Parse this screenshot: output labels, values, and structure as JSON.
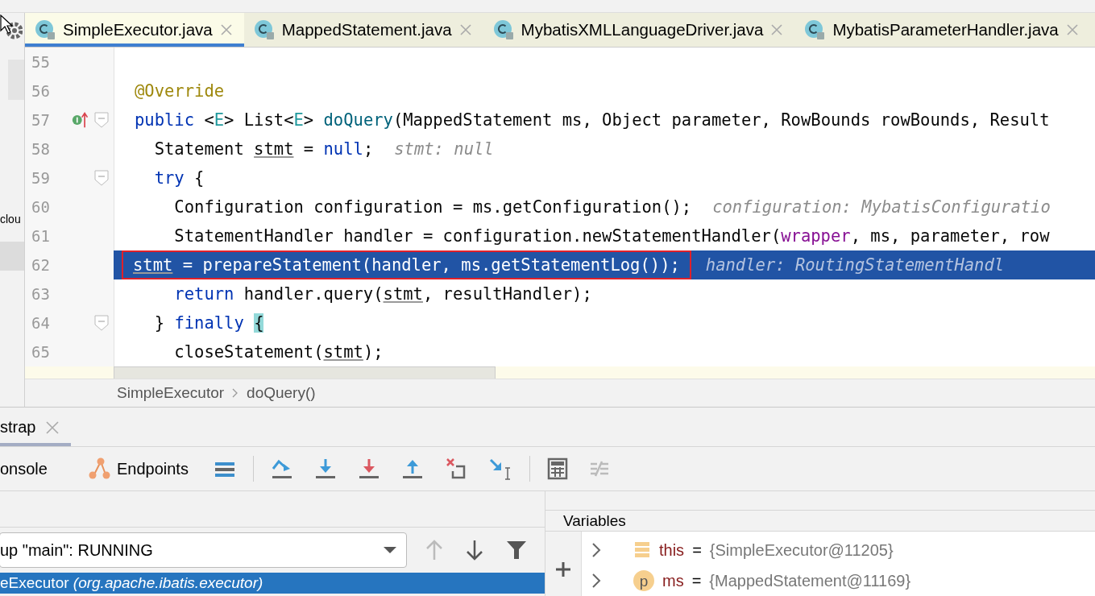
{
  "left_strip": {
    "text": "clou"
  },
  "editor_tabs": [
    {
      "label": "SimpleExecutor.java",
      "selected": true
    },
    {
      "label": "MappedStatement.java",
      "selected": false
    },
    {
      "label": "MybatisXMLLanguageDriver.java",
      "selected": false
    },
    {
      "label": "MybatisParameterHandler.java",
      "selected": false
    }
  ],
  "code": {
    "lines": [
      {
        "number": "55",
        "current": false,
        "foldable": false,
        "implements_marker": false,
        "framed": false
      },
      {
        "number": "56",
        "current": false,
        "foldable": false,
        "implements_marker": false,
        "framed": false,
        "tokens": [
          {
            "kind": "annotation",
            "text": "@Override"
          }
        ]
      },
      {
        "number": "57",
        "current": false,
        "foldable": true,
        "implements_marker": true,
        "framed": false,
        "tokens": [
          {
            "kind": "keyword",
            "text": "public"
          },
          {
            "kind": "plain",
            "text": " <"
          },
          {
            "kind": "typeparam",
            "text": "E"
          },
          {
            "kind": "plain",
            "text": "> List<"
          },
          {
            "kind": "typeparam",
            "text": "E"
          },
          {
            "kind": "plain",
            "text": "> "
          },
          {
            "kind": "method",
            "text": "doQuery"
          },
          {
            "kind": "plain",
            "text": "(MappedStatement ms, Object parameter, RowBounds rowBounds, Result"
          }
        ]
      },
      {
        "number": "58",
        "current": false,
        "foldable": false,
        "implements_marker": false,
        "framed": false,
        "tokens": [
          {
            "kind": "plain",
            "text": "  Statement "
          },
          {
            "kind": "variable",
            "text": "stmt"
          },
          {
            "kind": "plain",
            "text": " = "
          },
          {
            "kind": "keyword",
            "text": "null"
          },
          {
            "kind": "plain",
            "text": ";"
          }
        ],
        "hint": "stmt: null"
      },
      {
        "number": "59",
        "current": false,
        "foldable": true,
        "implements_marker": false,
        "framed": false,
        "tokens": [
          {
            "kind": "keyword",
            "text": "  try"
          },
          {
            "kind": "plain",
            "text": " {"
          }
        ]
      },
      {
        "number": "60",
        "current": false,
        "foldable": false,
        "implements_marker": false,
        "framed": false,
        "tokens": [
          {
            "kind": "plain",
            "text": "    Configuration configuration = ms.getConfiguration();"
          }
        ],
        "hint": "configuration: MybatisConfiguratio"
      },
      {
        "number": "61",
        "current": false,
        "foldable": false,
        "implements_marker": false,
        "framed": false,
        "tokens": [
          {
            "kind": "plain",
            "text": "    StatementHandler handler = configuration.newStatementHandler("
          },
          {
            "kind": "param",
            "text": "wrapper"
          },
          {
            "kind": "plain",
            "text": ", ms, parameter, row"
          }
        ]
      },
      {
        "number": "62",
        "current": true,
        "foldable": false,
        "implements_marker": false,
        "framed": true,
        "tokens": [
          {
            "kind": "variable",
            "text": "stmt"
          },
          {
            "kind": "plain",
            "text": " = prepareStatement(handler, ms.getStatementLog());"
          }
        ],
        "hint": "handler: RoutingStatementHandl"
      },
      {
        "number": "63",
        "current": false,
        "foldable": false,
        "implements_marker": false,
        "framed": false,
        "tokens": [
          {
            "kind": "keyword",
            "text": "    return"
          },
          {
            "kind": "plain",
            "text": " handler.query("
          },
          {
            "kind": "variable",
            "text": "stmt"
          },
          {
            "kind": "plain",
            "text": ", resultHandler);"
          }
        ]
      },
      {
        "number": "64",
        "current": false,
        "foldable": true,
        "implements_marker": false,
        "framed": false,
        "tokens": [
          {
            "kind": "plain",
            "text": "  } "
          },
          {
            "kind": "keyword",
            "text": "finally "
          },
          {
            "kind": "brace",
            "text": "{"
          }
        ]
      },
      {
        "number": "65",
        "current": false,
        "foldable": false,
        "implements_marker": false,
        "framed": false,
        "tokens": [
          {
            "kind": "plain",
            "text": "    closeStatement("
          },
          {
            "kind": "variable",
            "text": "stmt"
          },
          {
            "kind": "plain",
            "text": ");"
          }
        ]
      }
    ]
  },
  "breadcrumb": [
    "SimpleExecutor",
    "doQuery()"
  ],
  "debug_tabs": [
    {
      "label": "strap",
      "selected": true
    }
  ],
  "toolbar_tabs": [
    {
      "label": "onsole",
      "kind": "console"
    },
    {
      "label": "Endpoints",
      "kind": "endpoints"
    }
  ],
  "frames": {
    "thread_selector": "up \"main\": RUNNING",
    "items": [
      {
        "method": "eExecutor",
        "package": "(org.apache.ibatis.executor)",
        "selected": true
      }
    ]
  },
  "variables": {
    "title": "Variables",
    "items": [
      {
        "kind": "field",
        "name": "this",
        "operator": "=",
        "value": "{SimpleExecutor@11205}"
      },
      {
        "kind": "param",
        "badge": "p",
        "name": "ms",
        "operator": "=",
        "value": "{MappedStatement@11169}"
      }
    ]
  }
}
